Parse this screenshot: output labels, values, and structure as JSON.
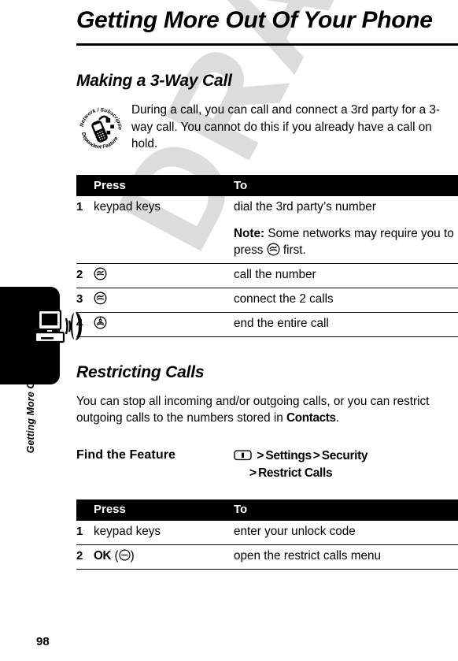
{
  "page": {
    "number": "98",
    "watermark": "DRAFT",
    "running_footer": "Getting More Out Of Your Phone"
  },
  "chapter": {
    "title": "Getting More Out Of Your Phone"
  },
  "sections": [
    {
      "heading": "Making a 3-Way Call",
      "badge_icon": "network-subscription-dependent-feature-icon",
      "badge_text": "Network / Subscription Dependent Feature",
      "body": "During a call, you can call and connect a 3rd party for a 3-way call. You cannot do this if you already have a call on hold."
    },
    {
      "heading": "Restricting Calls",
      "body_pre": "You can stop all incoming and/or outgoing calls, or you can restrict outgoing calls to the numbers stored in ",
      "body_emphasis": "Contacts",
      "body_post": "."
    }
  ],
  "find_the_feature": {
    "label": "Find the Feature",
    "menu_key_icon": "menu-key-icon",
    "path_line1_item1": "Settings",
    "path_line1_item2": "Security",
    "path_line2_item1": "Restrict Calls",
    "separator": ">"
  },
  "tables": [
    {
      "name": "three-way-call-steps",
      "headers": {
        "num": "",
        "press": "Press",
        "to": "To"
      },
      "rows": [
        {
          "num": "1",
          "press_text": "keypad keys",
          "press_icon": "",
          "to_text": "dial the 3rd party’s number",
          "note_lead": "Note:",
          "note_pre": " Some networks may require you to press ",
          "note_icon": "send-key-icon",
          "note_post": " first."
        },
        {
          "num": "2",
          "press_text": "",
          "press_icon": "send-key-icon",
          "to_text": "call the number"
        },
        {
          "num": "3",
          "press_text": "",
          "press_icon": "send-key-icon",
          "to_text": "connect the 2 calls"
        },
        {
          "num": "4",
          "press_text": "",
          "press_icon": "power-end-key-icon",
          "to_text": "end the entire call"
        }
      ]
    },
    {
      "name": "restrict-calls-steps",
      "headers": {
        "num": "",
        "press": "Press",
        "to": "To"
      },
      "rows": [
        {
          "num": "1",
          "press_text": "keypad keys",
          "press_icon": "",
          "to_text": "enter your unlock code"
        },
        {
          "num": "2",
          "press_label": "OK",
          "press_paren_open": "(",
          "press_icon": "soft-key-icon",
          "press_paren_close": ")",
          "to_text": "open the restrict calls menu"
        }
      ]
    }
  ],
  "colors": {
    "ink": "#000000",
    "paper": "#ffffff",
    "watermark": "#dcdcdc",
    "header_bar": "#000000",
    "header_text": "#ffffff"
  }
}
